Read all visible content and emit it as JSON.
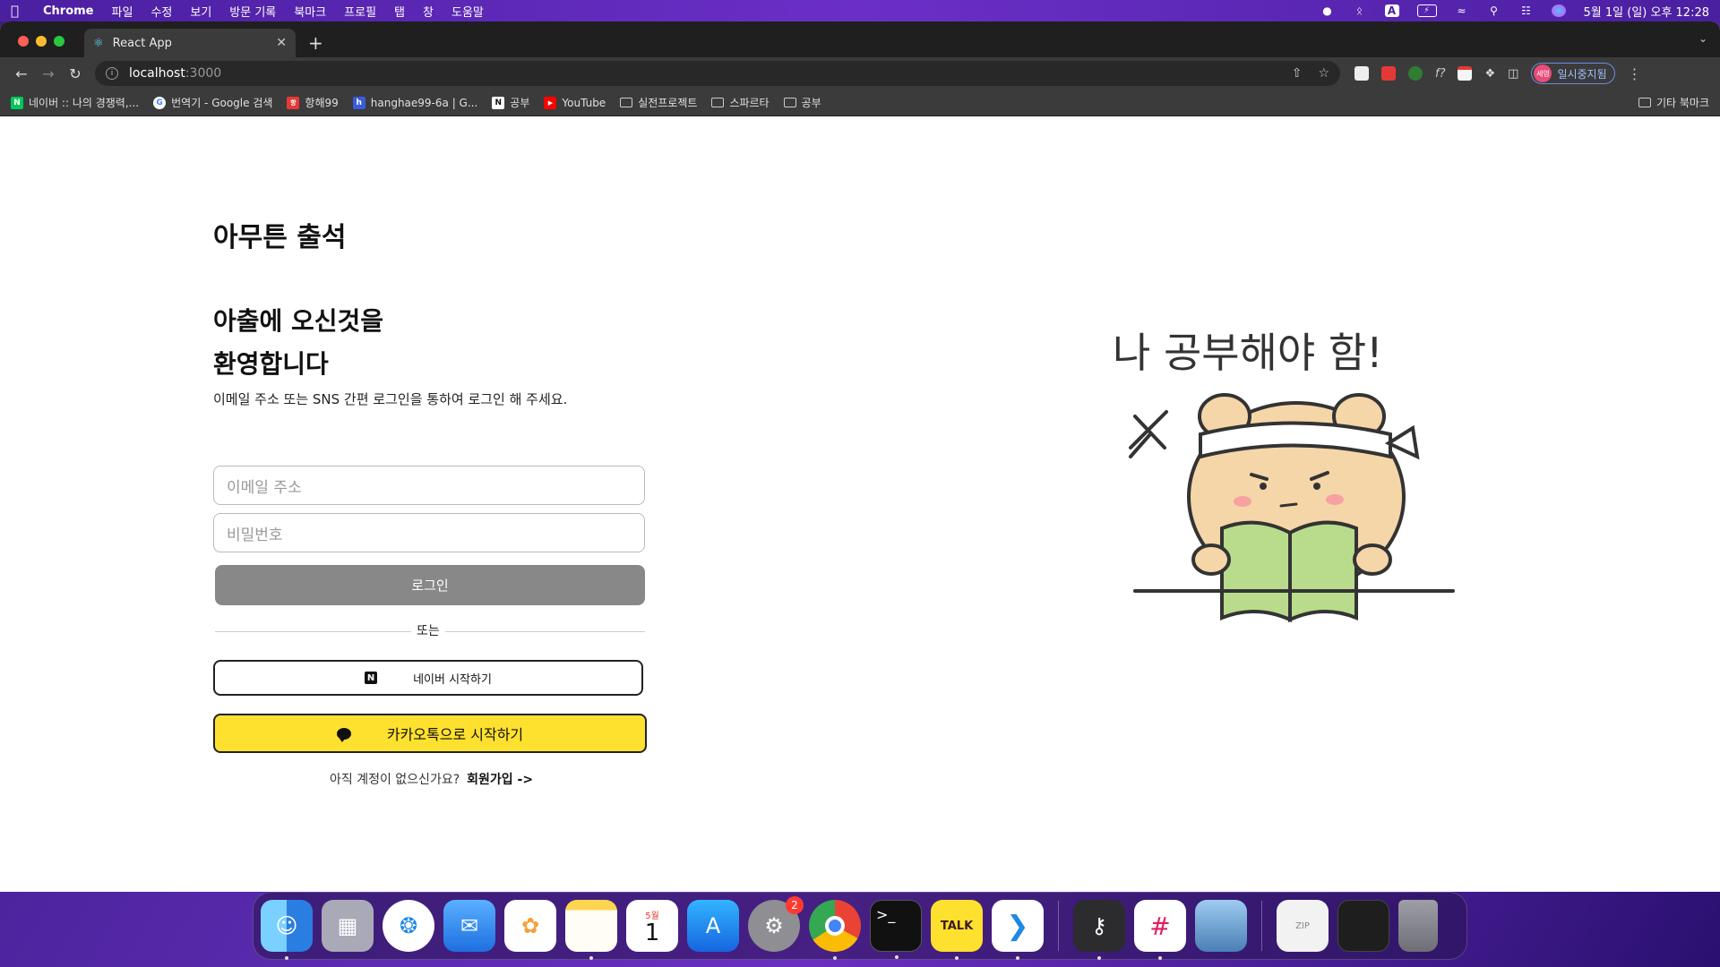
{
  "menubar": {
    "app_name": "Chrome",
    "menus": [
      "파일",
      "수정",
      "보기",
      "방문 기록",
      "북마크",
      "프로필",
      "탭",
      "창",
      "도움말"
    ],
    "datetime": "5월 1일 (일) 오후 12:28"
  },
  "browser": {
    "tab_title": "React App",
    "url_host": "localhost",
    "url_port": ":3000",
    "profile_label": "일시중지됨",
    "profile_avatar": "세영",
    "bookmarks": [
      {
        "label": "네이버 :: 나의 경쟁력,...",
        "icon": "N",
        "color": "#03c75a"
      },
      {
        "label": "번역기 - Google 검색",
        "icon": "G",
        "color": "#ffffff"
      },
      {
        "label": "항해99",
        "icon": "항",
        "color": "#e53935"
      },
      {
        "label": "hanghae99-6a | G...",
        "icon": "h",
        "color": "#3b5bdb"
      },
      {
        "label": "공부",
        "icon": "N",
        "color": "#ffffff"
      },
      {
        "label": "YouTube",
        "icon": "▶",
        "color": "#ff0000"
      },
      {
        "label": "실전프로젝트",
        "icon": "folder",
        "color": ""
      },
      {
        "label": "스파르타",
        "icon": "folder",
        "color": ""
      },
      {
        "label": "공부",
        "icon": "folder",
        "color": ""
      }
    ],
    "other_bookmarks": "기타 북마크"
  },
  "page": {
    "brand": "아무튼 출석",
    "welcome_line1": "아출에 오신것을",
    "welcome_line2": "환영합니다",
    "subtitle": "이메일 주소 또는 SNS 간편 로그인을 통하여 로그인 해 주세요.",
    "email_placeholder": "이메일 주소",
    "password_placeholder": "비밀번호",
    "login_label": "로그인",
    "divider_label": "또는",
    "naver_label": "네이버 시작하기",
    "kakao_label": "카카오톡으로 시작하기",
    "signup_prompt": "아직 계정이 없으신가요?",
    "signup_link": "회원가입 ->",
    "illustration_text": "나 공부해야 함!"
  },
  "dock": {
    "calendar_month": "5월",
    "calendar_day": "1",
    "settings_badge": "2",
    "kakao_icon_text": "TALK"
  },
  "colors": {
    "kakao_yellow": "#fee12e",
    "login_gray": "#888888",
    "menubar_purple": "#5b2bb0"
  }
}
